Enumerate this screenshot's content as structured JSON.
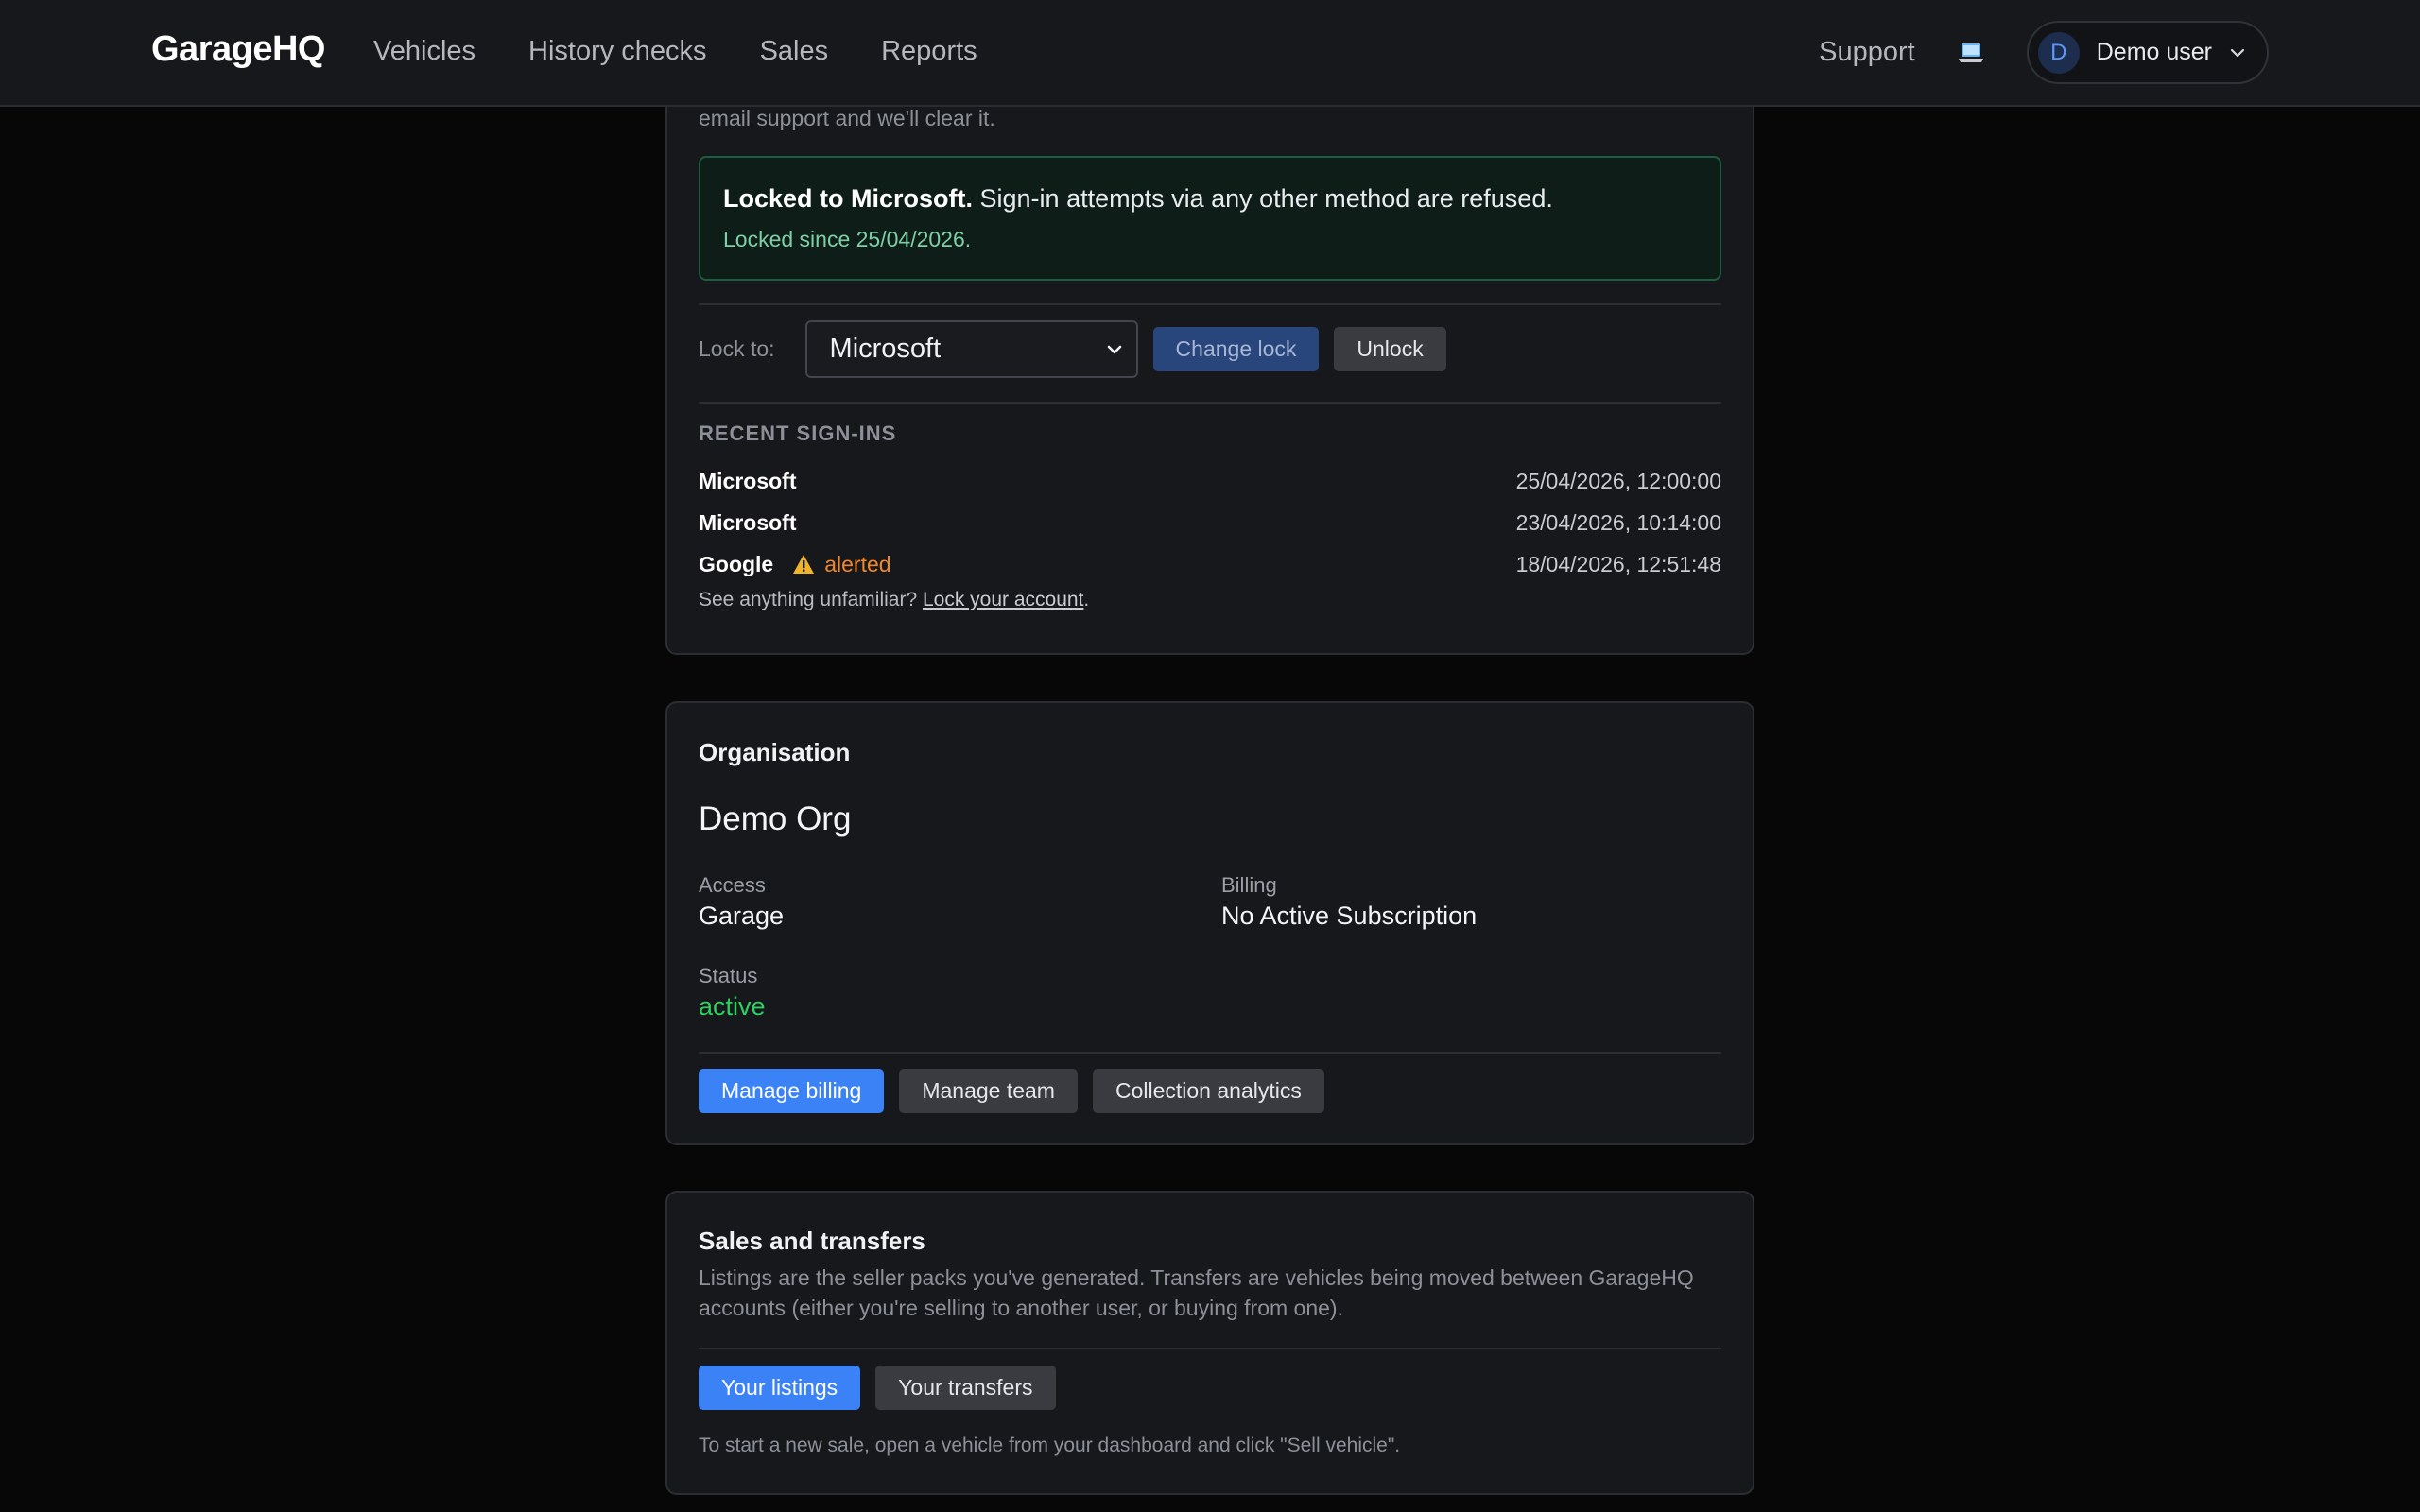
{
  "nav": {
    "brand": "GarageHQ",
    "links": [
      "Vehicles",
      "History checks",
      "Sales",
      "Reports"
    ],
    "support": "Support",
    "user": {
      "initial": "D",
      "name": "Demo user"
    }
  },
  "security": {
    "intro_tail": "email support and we'll clear it.",
    "lock_alert": {
      "strong": "Locked to Microsoft.",
      "message": " Sign-in attempts via any other method are refused.",
      "since": "Locked since 25/04/2026."
    },
    "lock_label": "Lock to:",
    "lock_select_value": "Microsoft",
    "change_lock_label": "Change lock",
    "unlock_label": "Unlock",
    "recent_label": "RECENT SIGN-INS",
    "signins": [
      {
        "method": "Microsoft",
        "time": "25/04/2026, 12:00:00",
        "flag": ""
      },
      {
        "method": "Microsoft",
        "time": "23/04/2026, 10:14:00",
        "flag": ""
      },
      {
        "method": "Google",
        "time": "18/04/2026, 12:51:48",
        "flag": "alerted"
      }
    ],
    "unfamiliar_prefix": "See anything unfamiliar? ",
    "unfamiliar_link": "Lock your account",
    "unfamiliar_suffix": "."
  },
  "organisation": {
    "title": "Organisation",
    "name": "Demo Org",
    "access_label": "Access",
    "access_value": "Garage",
    "billing_label": "Billing",
    "billing_value": "No Active Subscription",
    "status_label": "Status",
    "status_value": "active",
    "buttons": {
      "manage_billing": "Manage billing",
      "manage_team": "Manage team",
      "collection_analytics": "Collection analytics"
    }
  },
  "sales": {
    "title": "Sales and transfers",
    "description": "Listings are the seller packs you've generated. Transfers are vehicles being moved between GarageHQ accounts (either you're selling to another user, or buying from one).",
    "your_listings": "Your listings",
    "your_transfers": "Your transfers",
    "hint": "To start a new sale, open a vehicle from your dashboard and click \"Sell vehicle\"."
  },
  "colors": {
    "background": "#070708",
    "card": "#17181b",
    "primary_button": "#3b82f6",
    "success": "#2fcf62",
    "warning": "#f0882b"
  }
}
